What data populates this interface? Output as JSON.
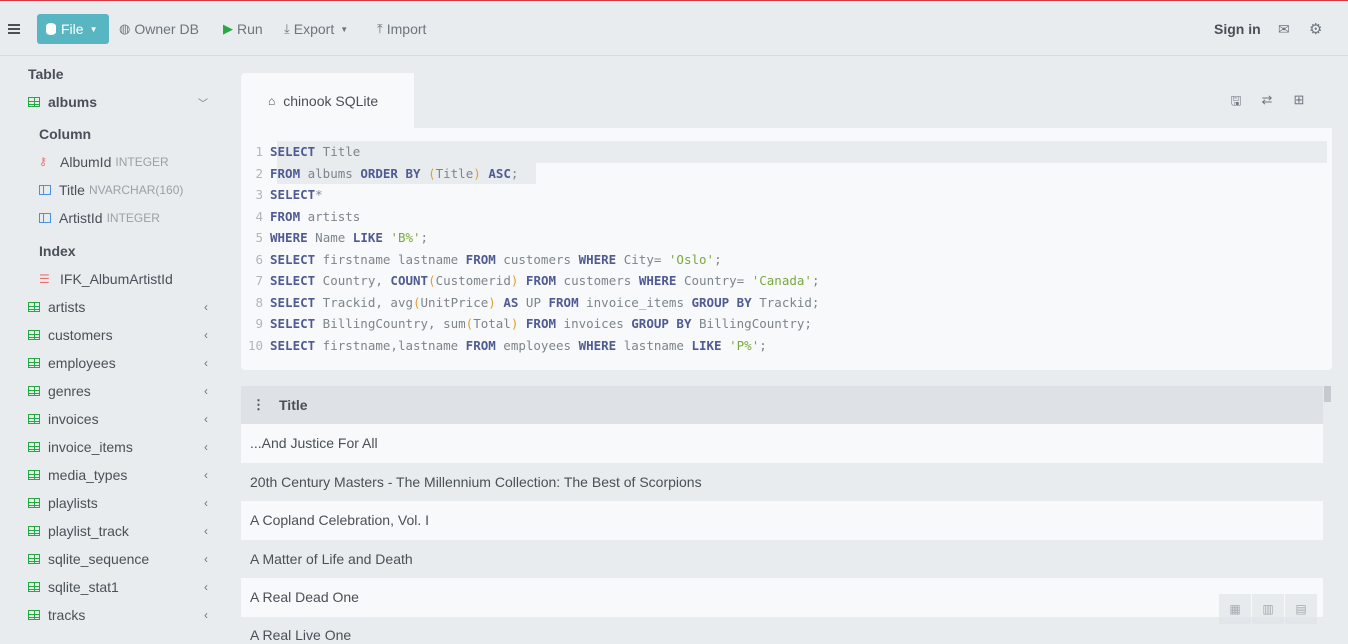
{
  "toolbar": {
    "file_label": "File",
    "owner_db_label": "Owner DB",
    "run_label": "Run",
    "export_label": "Export",
    "import_label": "Import",
    "sign_in_label": "Sign in"
  },
  "sidebar": {
    "table_heading": "Table",
    "active_table": "albums",
    "column_heading": "Column",
    "columns": [
      {
        "name": "AlbumId",
        "type": "INTEGER",
        "icon": "key-icon"
      },
      {
        "name": "Title",
        "type": "NVARCHAR(160)",
        "icon": "column-icon"
      },
      {
        "name": "ArtistId",
        "type": "INTEGER",
        "icon": "column-icon"
      }
    ],
    "index_heading": "Index",
    "indexes": [
      "IFK_AlbumArtistId"
    ],
    "tables": [
      "artists",
      "customers",
      "employees",
      "genres",
      "invoices",
      "invoice_items",
      "media_types",
      "playlists",
      "playlist_track",
      "sqlite_sequence",
      "sqlite_stat1",
      "tracks"
    ]
  },
  "editor": {
    "tab_label": "chinook SQLite",
    "line_numbers": [
      "1",
      "2",
      "3",
      "4",
      "5",
      "6",
      "7",
      "8",
      "9",
      "10"
    ]
  },
  "results": {
    "column_header": "Title",
    "rows": [
      "...And Justice For All",
      "20th Century Masters - The Millennium Collection: The Best of Scorpions",
      "A Copland Celebration, Vol. I",
      "A Matter of Life and Death",
      "A Real Dead One",
      "A Real Live One"
    ]
  },
  "colors": {
    "file_button": "#58b5c2",
    "table_icon": "#28a745",
    "column_icon": "#4a90e2",
    "key_icon": "#e57373",
    "sql_keyword": "#4f5b93",
    "sql_string": "#7aa83f",
    "run_icon": "#28a745"
  }
}
